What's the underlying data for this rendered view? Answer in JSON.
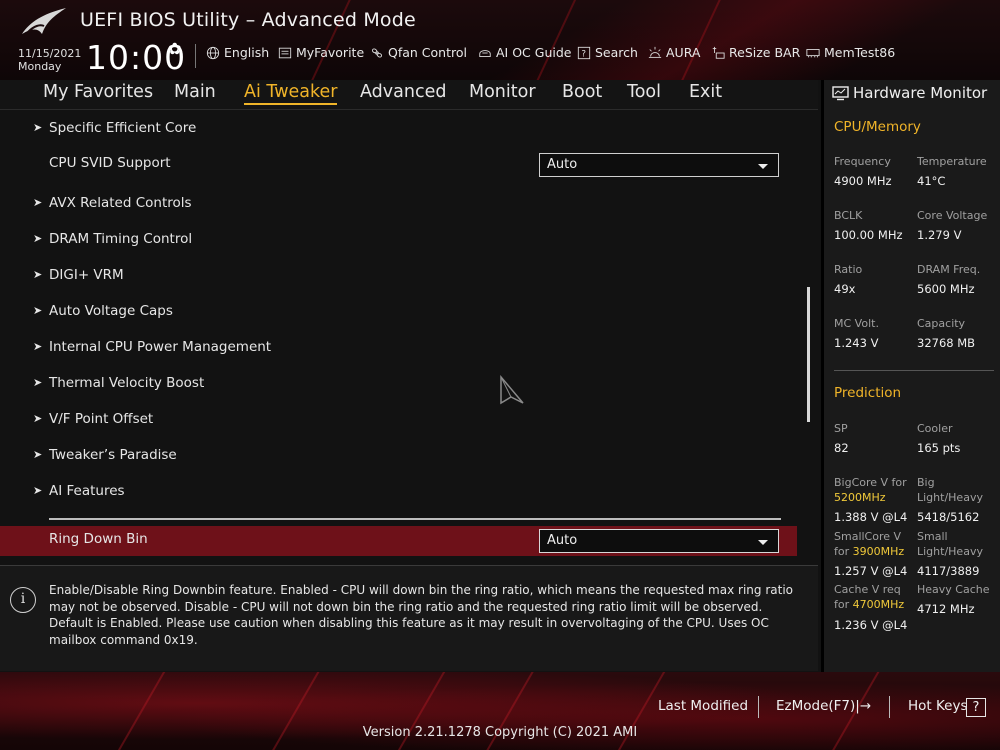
{
  "header": {
    "title": "UEFI BIOS Utility – Advanced Mode",
    "date": "11/15/2021",
    "day": "Monday",
    "time": "10:00",
    "toolbar": [
      {
        "label": "English",
        "icon": "globe-icon"
      },
      {
        "label": "MyFavorite",
        "icon": "favorite-icon"
      },
      {
        "label": "Qfan Control",
        "icon": "fan-icon"
      },
      {
        "label": "AI OC Guide",
        "icon": "ai-oc-icon"
      },
      {
        "label": "Search",
        "icon": "search-icon"
      },
      {
        "label": "AURA",
        "icon": "aura-icon"
      },
      {
        "label": "ReSize BAR",
        "icon": "resize-bar-icon"
      },
      {
        "label": "MemTest86",
        "icon": "memtest-icon"
      }
    ]
  },
  "nav": {
    "tabs": [
      "My Favorites",
      "Main",
      "Ai Tweaker",
      "Advanced",
      "Monitor",
      "Boot",
      "Tool",
      "Exit"
    ],
    "active": "Ai Tweaker"
  },
  "main": {
    "items": [
      {
        "label": "Specific Efficient Core",
        "submenu": true
      },
      {
        "label": "CPU SVID Support",
        "submenu": false,
        "value": "Auto"
      },
      {
        "label": "AVX Related Controls",
        "submenu": true
      },
      {
        "label": "DRAM Timing Control",
        "submenu": true
      },
      {
        "label": "DIGI+ VRM",
        "submenu": true
      },
      {
        "label": "Auto Voltage Caps",
        "submenu": true
      },
      {
        "label": "Internal CPU Power Management",
        "submenu": true
      },
      {
        "label": "Thermal Velocity Boost",
        "submenu": true
      },
      {
        "label": "V/F Point Offset",
        "submenu": true
      },
      {
        "label": "Tweaker’s Paradise",
        "submenu": true
      },
      {
        "label": "AI Features",
        "submenu": true
      },
      {
        "label": "Ring Down Bin",
        "submenu": false,
        "value": "Auto",
        "selected": true
      }
    ]
  },
  "help": {
    "text": "Enable/Disable Ring Downbin feature. Enabled - CPU will down bin the ring ratio, which means the requested max ring ratio may not be observed. Disable - CPU will not down bin the ring ratio and the requested ring ratio limit will be observed. Default is Enabled. Please use caution when disabling this feature as it may result in overvoltaging of the CPU. Uses OC mailbox command 0x19."
  },
  "hw_monitor": {
    "title": "Hardware Monitor",
    "cpu_mem_title": "CPU/Memory",
    "cpu_mem": [
      {
        "label": "Frequency",
        "value": "4900 MHz"
      },
      {
        "label": "Temperature",
        "value": "41°C"
      },
      {
        "label": "BCLK",
        "value": "100.00 MHz"
      },
      {
        "label": "Core Voltage",
        "value": "1.279 V"
      },
      {
        "label": "Ratio",
        "value": "49x"
      },
      {
        "label": "DRAM Freq.",
        "value": "5600 MHz"
      },
      {
        "label": "MC Volt.",
        "value": "1.243 V"
      },
      {
        "label": "Capacity",
        "value": "32768 MB"
      }
    ],
    "prediction_title": "Prediction",
    "sp_label": "SP",
    "sp_value": "82",
    "cooler_label": "Cooler",
    "cooler_value": "165 pts",
    "bigcore_label": "BigCore V for",
    "bigcore_freq": "5200MHz",
    "bigcore_value": "1.388 V @L4",
    "big_label_1": "Big",
    "big_label_2": "Light/Heavy",
    "big_value": "5418/5162",
    "smallcore_label": "SmallCore V",
    "smallcore_for": "for",
    "smallcore_freq": "3900MHz",
    "smallcore_value": "1.257 V @L4",
    "small_label_1": "Small",
    "small_label_2": "Light/Heavy",
    "small_value": "4117/3889",
    "cachev_label": "Cache V req",
    "cachev_for": "for",
    "cachev_freq": "4700MHz",
    "cachev_value": "1.236 V @L4",
    "heavycache_label": "Heavy Cache",
    "heavycache_value": "4712 MHz"
  },
  "footer": {
    "last_modified": "Last Modified",
    "ezmode": "EzMode(F7)|→",
    "hotkeys": "Hot Keys",
    "hotkeys_key": "?",
    "version": "Version 2.21.1278 Copyright (C) 2021 AMI"
  },
  "colors": {
    "accent": "#f0b429",
    "selected_row": "#6e1119",
    "background": "#121212"
  }
}
